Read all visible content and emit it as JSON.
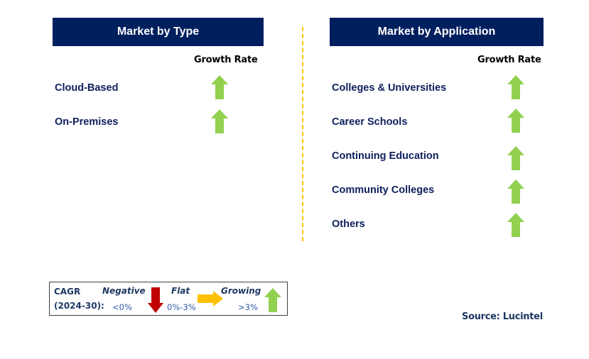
{
  "left_panel": {
    "title": "Market by Type",
    "growth_rate_label": "Growth Rate",
    "items": [
      {
        "label": "Cloud-Based",
        "trend": "growing"
      },
      {
        "label": "On-Premises",
        "trend": "growing"
      }
    ]
  },
  "right_panel": {
    "title": "Market by Application",
    "growth_rate_label": "Growth Rate",
    "items": [
      {
        "label": "Colleges & Universities",
        "trend": "growing"
      },
      {
        "label": "Career Schools",
        "trend": "growing"
      },
      {
        "label": "Continuing Education",
        "trend": "growing"
      },
      {
        "label": "Community Colleges",
        "trend": "growing"
      },
      {
        "label": "Others",
        "trend": "growing"
      }
    ]
  },
  "legend": {
    "cagr_label": "CAGR",
    "period_label": "(2024-30):",
    "negative": {
      "label": "Negative",
      "range": "<0%",
      "icon": "arrow-down-red"
    },
    "flat": {
      "label": "Flat",
      "range": "0%-3%",
      "icon": "arrow-right-yellow"
    },
    "growing": {
      "label": "Growing",
      "range": ">3%",
      "icon": "arrow-up-green"
    }
  },
  "source": "Source: Lucintel",
  "colors": {
    "header_bg": "#001f5f",
    "header_text": "#ffffff",
    "item_text": "#0d1f5c",
    "growing": "#92d050",
    "flat": "#ffc000",
    "negative": "#c00000",
    "divider": "#ffc000"
  }
}
